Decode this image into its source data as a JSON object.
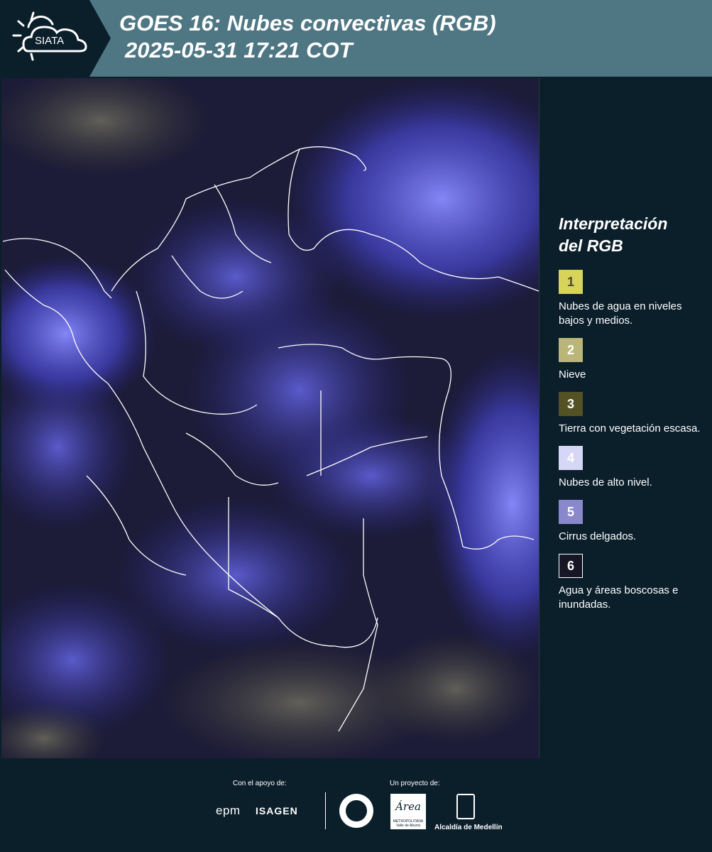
{
  "header": {
    "logo_text": "SIATA",
    "title_line1": "GOES 16: Nubes convectivas (RGB)",
    "title_line2": "2025-05-31 17:21 COT",
    "background_color": "#4e7683"
  },
  "legend": {
    "title_line1": "Interpretación",
    "title_line2": "del RGB",
    "items": [
      {
        "number": "1",
        "label": "Nubes de agua en niveles bajos y medios.",
        "color": "#d8d35a",
        "text_color": "#4a4a2a"
      },
      {
        "number": "2",
        "label": "Nieve",
        "color": "#b9b678",
        "text_color": "#ffffff"
      },
      {
        "number": "3",
        "label": "Tierra con vegetación escasa.",
        "color": "#545224",
        "text_color": "#ffffff"
      },
      {
        "number": "4",
        "label": "Nubes de alto nivel.",
        "color": "#d6d6f6",
        "text_color": "#ffffff"
      },
      {
        "number": "5",
        "label": "Cirrus delgados.",
        "color": "#8a88cc",
        "text_color": "#ffffff"
      },
      {
        "number": "6",
        "label": "Agua y áreas boscosas e inundadas.",
        "color": "#171624",
        "text_color": "#ffffff",
        "border": "#ffffff"
      }
    ]
  },
  "footer": {
    "support_label": "Con el apoyo de:",
    "project_label": "Un proyecto de:",
    "sponsors": [
      "epm",
      "ISAGEN"
    ],
    "area_logo_text": "Área",
    "area_logo_sub": "METROPOLITANA Valle de Aburrá",
    "alcaldia_label": "Alcaldía de Medellín"
  },
  "map": {
    "description_icon": "satellite-rgb-image",
    "land_color": "#1e1d3a",
    "cloud_color": "#5a5ae8",
    "border_color": "#ffffff"
  }
}
